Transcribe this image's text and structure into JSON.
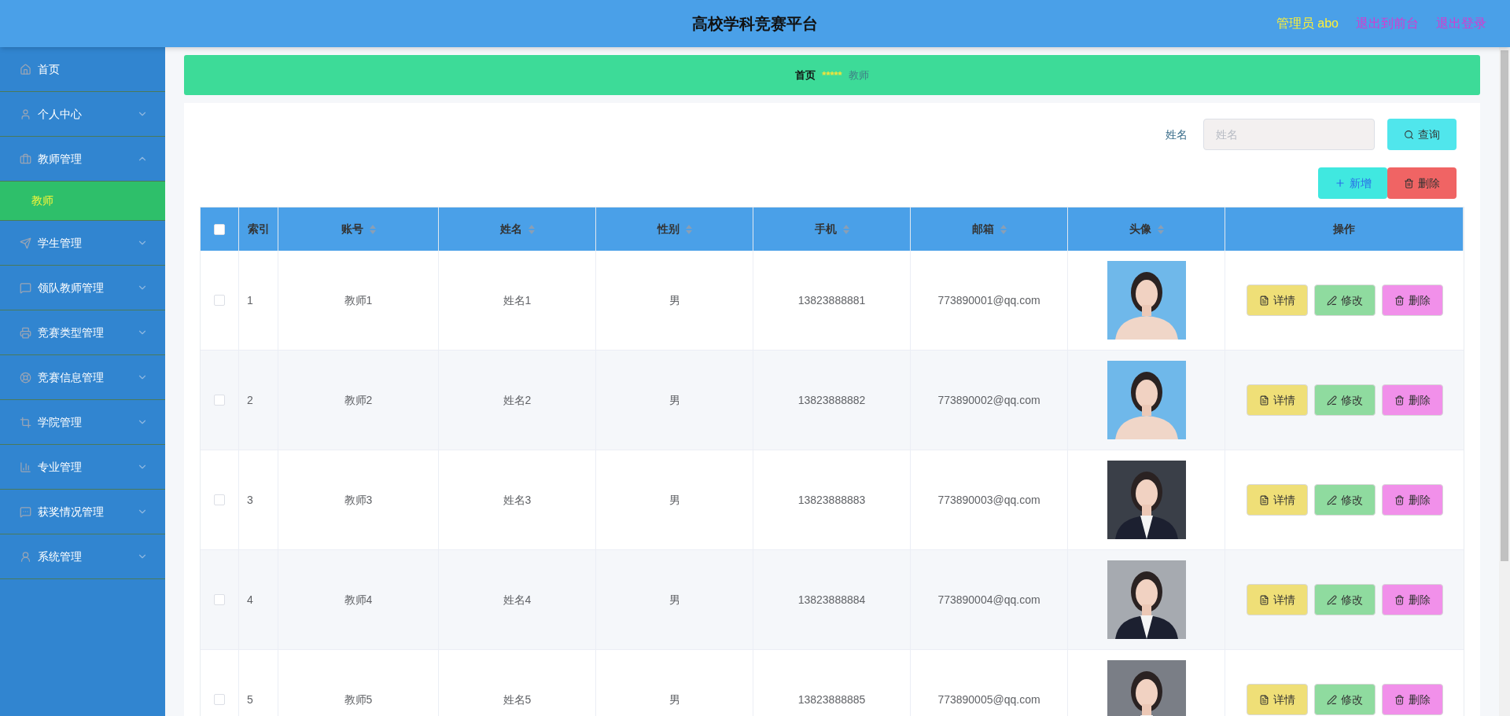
{
  "header": {
    "title": "高校学科竞赛平台",
    "user": "管理员 abo",
    "links": [
      "退出到前台",
      "退出登录"
    ]
  },
  "sidebar": {
    "items": [
      {
        "label": "首页",
        "kind": "link"
      },
      {
        "label": "个人中心",
        "kind": "menu",
        "expanded": false
      },
      {
        "label": "教师管理",
        "kind": "menu",
        "expanded": true,
        "children": [
          {
            "label": "教师",
            "selected": true
          }
        ]
      },
      {
        "label": "学生管理",
        "kind": "menu",
        "expanded": false
      },
      {
        "label": "领队教师管理",
        "kind": "menu",
        "expanded": false
      },
      {
        "label": "竞赛类型管理",
        "kind": "menu",
        "expanded": false
      },
      {
        "label": "竞赛信息管理",
        "kind": "menu",
        "expanded": false
      },
      {
        "label": "学院管理",
        "kind": "menu",
        "expanded": false
      },
      {
        "label": "专业管理",
        "kind": "menu",
        "expanded": false
      },
      {
        "label": "获奖情况管理",
        "kind": "menu",
        "expanded": false
      },
      {
        "label": "系统管理",
        "kind": "menu",
        "expanded": false
      }
    ]
  },
  "breadcrumb": {
    "home": "首页",
    "separator": "*****",
    "current": "教师"
  },
  "search": {
    "label": "姓名",
    "placeholder": "姓名",
    "button": "查询"
  },
  "toolbar": {
    "add": "新增",
    "delete": "删除"
  },
  "table": {
    "header_checked": false,
    "columns": [
      {
        "label": "索引",
        "sortable": false
      },
      {
        "label": "账号",
        "sortable": true
      },
      {
        "label": "姓名",
        "sortable": true
      },
      {
        "label": "性别",
        "sortable": true
      },
      {
        "label": "手机",
        "sortable": true
      },
      {
        "label": "邮箱",
        "sortable": true
      },
      {
        "label": "头像",
        "sortable": true
      },
      {
        "label": "操作",
        "sortable": false
      }
    ],
    "rows": [
      {
        "checked": false,
        "index": "1",
        "account": "教师1",
        "name": "姓名1",
        "gender": "男",
        "phone": "13823888881",
        "email": "773890001@qq.com",
        "actions": [
          "详情",
          "修改",
          "删除"
        ]
      },
      {
        "checked": false,
        "index": "2",
        "account": "教师2",
        "name": "姓名2",
        "gender": "男",
        "phone": "13823888882",
        "email": "773890002@qq.com",
        "actions": [
          "详情",
          "修改",
          "删除"
        ]
      },
      {
        "checked": false,
        "index": "3",
        "account": "教师3",
        "name": "姓名3",
        "gender": "男",
        "phone": "13823888883",
        "email": "773890003@qq.com",
        "actions": [
          "详情",
          "修改",
          "删除"
        ]
      },
      {
        "checked": false,
        "index": "4",
        "account": "教师4",
        "name": "姓名4",
        "gender": "男",
        "phone": "13823888884",
        "email": "773890004@qq.com",
        "actions": [
          "详情",
          "修改",
          "删除"
        ]
      },
      {
        "checked": false,
        "index": "5",
        "account": "教师5",
        "name": "姓名5",
        "gender": "男",
        "phone": "13823888885",
        "email": "773890005@qq.com",
        "actions": [
          "详情",
          "修改",
          "删除"
        ]
      }
    ]
  }
}
